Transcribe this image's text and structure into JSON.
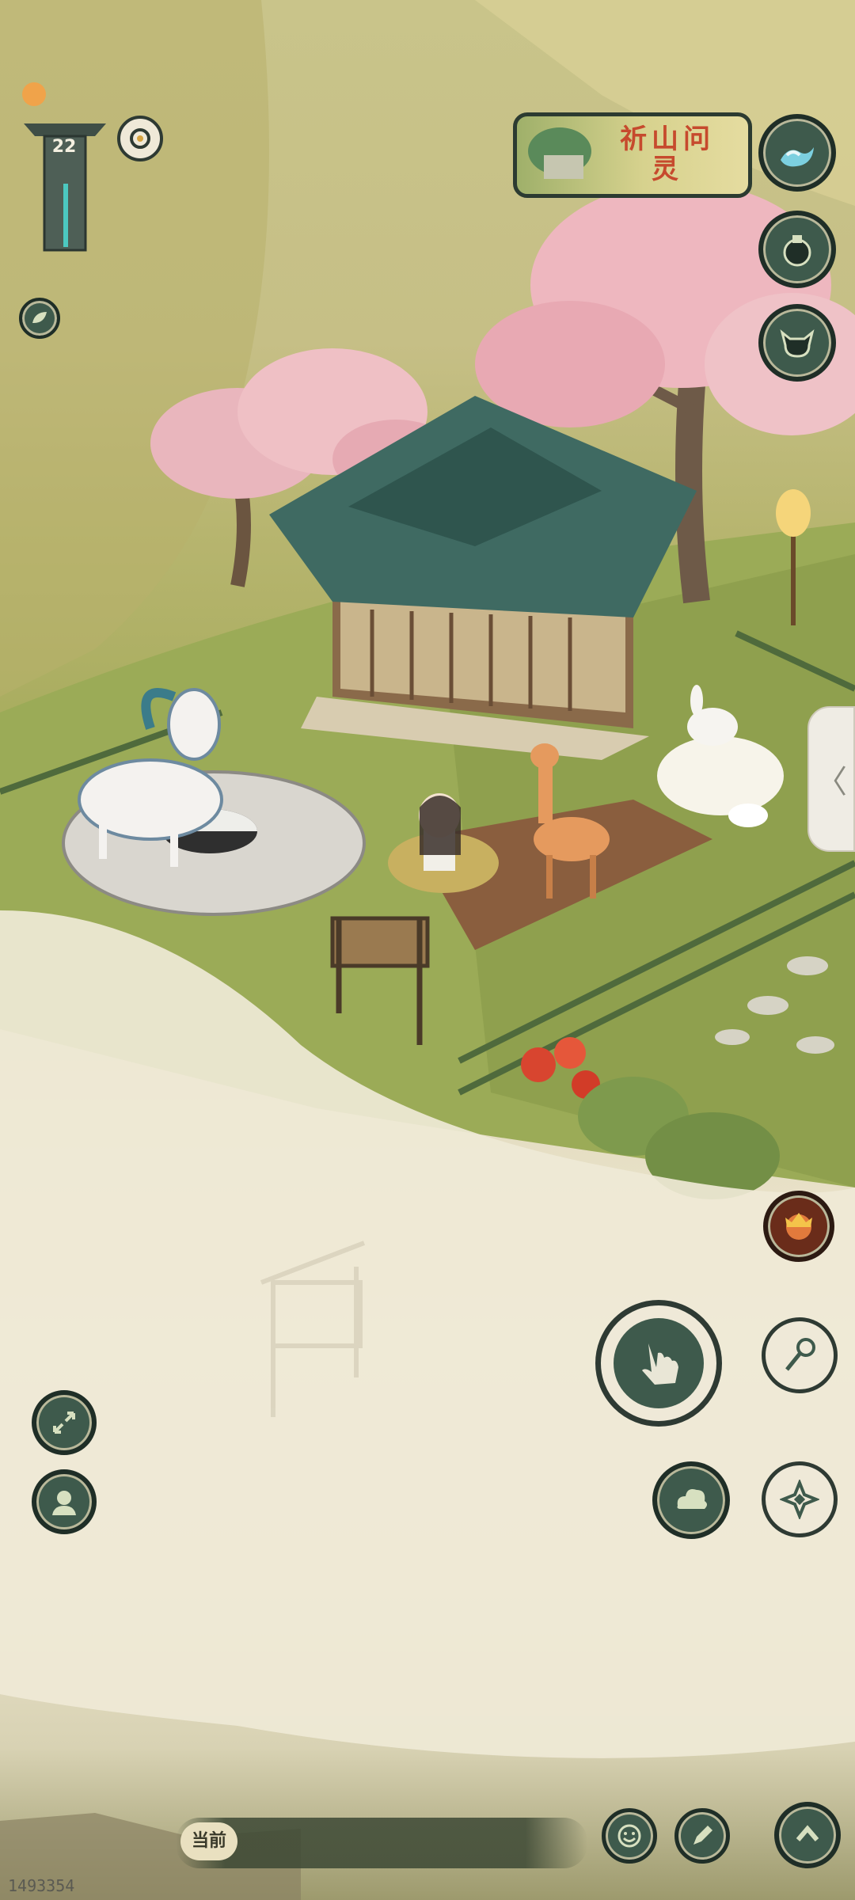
{
  "hud": {
    "level": "22",
    "event_banner_title": "祈山问灵"
  },
  "chat": {
    "channel_tag": "当前"
  },
  "footer": {
    "user_id": "1493354"
  },
  "side_tab": {
    "arrow": "〈"
  },
  "icons": {
    "wave": "wave-icon",
    "bag": "bag-icon",
    "spirit": "spirit-icon",
    "leaf": "leaf-icon",
    "expand": "expand-icon",
    "character": "character-icon",
    "interact": "hand-pointer-icon",
    "tool": "net-tool-icon",
    "cloud": "cloud-icon",
    "compass": "compass-icon",
    "emoji": "emoji-icon",
    "edit": "edit-icon",
    "up": "chevron-up-icon",
    "monkey": "monkey-avatar-icon"
  },
  "colors": {
    "button_dark": "#3e5a4c",
    "banner_text": "#c64a2d",
    "roof": "#3f6a62",
    "blossom": "#eab0b8"
  }
}
